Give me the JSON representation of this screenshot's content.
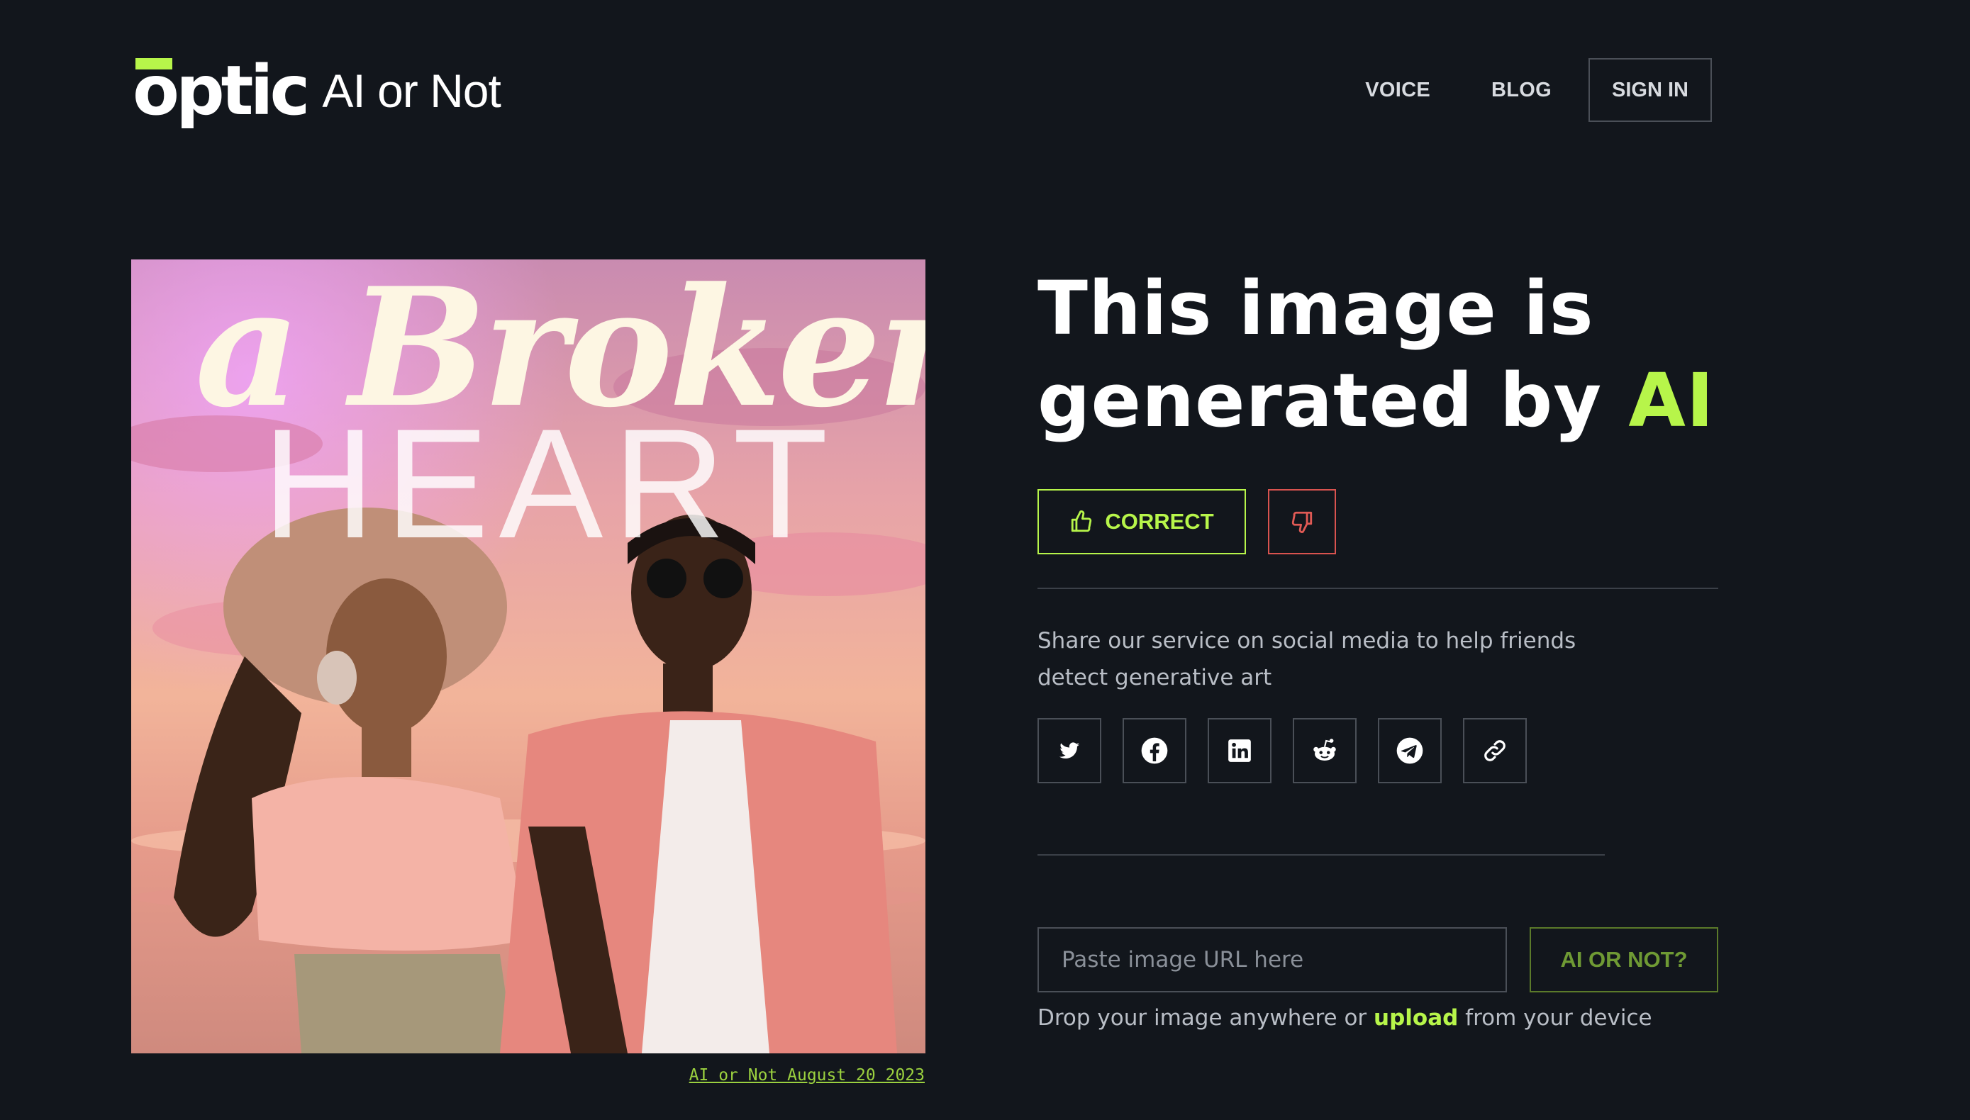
{
  "brand": {
    "logo_text": "optic",
    "product_name": "AI or Not",
    "accent_color": "#b7f54a"
  },
  "nav": {
    "voice": "VOICE",
    "blog": "BLOG",
    "sign_in": "SIGN IN"
  },
  "image": {
    "title_text": "a Broken",
    "subtitle_text": "HEART",
    "caption": "AI or Not August 20 2023"
  },
  "result": {
    "headline_line1": "This image is",
    "headline_line2": "generated by ",
    "verdict": "AI",
    "correct_label": "CORRECT",
    "correct_icon": "thumbs-up-icon",
    "wrong_icon": "thumbs-down-icon"
  },
  "share": {
    "text": "Share our service on social media to help friends detect generative art",
    "icons": [
      "twitter-icon",
      "facebook-icon",
      "linkedin-icon",
      "reddit-icon",
      "telegram-icon",
      "link-icon"
    ]
  },
  "submit": {
    "placeholder": "Paste image URL here",
    "button_label": "AI OR NOT?",
    "drop_prefix": "Drop your image anywhere or ",
    "drop_link": "upload",
    "drop_suffix": " from your device"
  }
}
